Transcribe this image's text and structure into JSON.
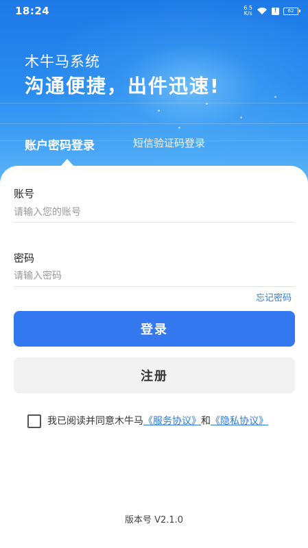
{
  "status_bar": {
    "time": "18:24",
    "net_speed_value": "6.5",
    "net_speed_unit": "K/s",
    "battery": "62"
  },
  "hero": {
    "app_name": "木牛马系统",
    "slogan": "沟通便捷，出件迅速!"
  },
  "tabs": {
    "password_login": "账户密码登录",
    "sms_login": "短信验证码登录",
    "active": "password_login"
  },
  "form": {
    "account_label": "账号",
    "account_placeholder": "请输入您的账号",
    "account_value": "",
    "password_label": "密码",
    "password_placeholder": "请输入密码",
    "password_value": "",
    "forgot_password": "忘记密码"
  },
  "buttons": {
    "login": "登录",
    "register": "注册"
  },
  "agreement": {
    "checked": false,
    "prefix": "我已阅读并同意木牛马",
    "service_link": "《服务协议》",
    "connector": "和",
    "privacy_link": "《隐私协议》"
  },
  "footer": {
    "version": "版本号 V2.1.0"
  },
  "colors": {
    "primary": "#3478f0",
    "link": "#2e7bdc",
    "hero_top": "#1d79e6",
    "hero_bottom": "#6fbef8"
  }
}
